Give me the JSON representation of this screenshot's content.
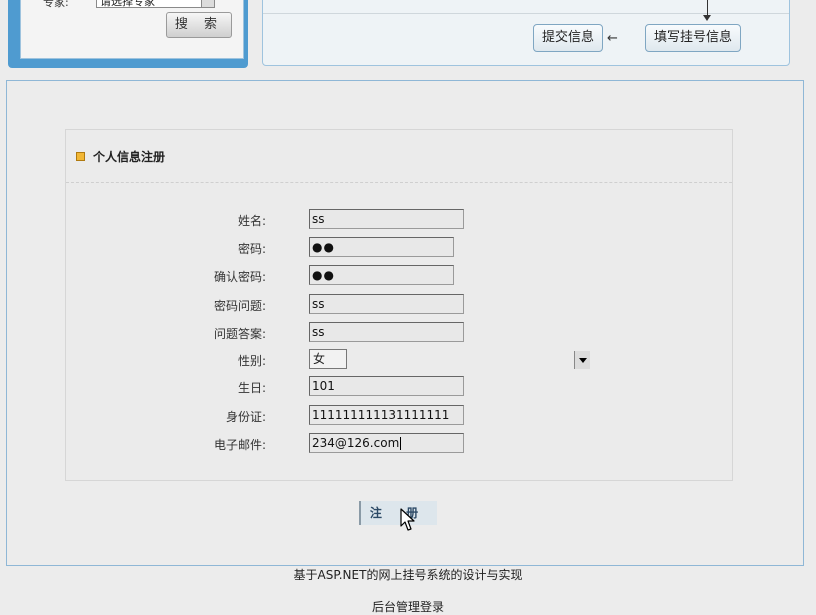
{
  "search": {
    "label": "专家:",
    "select_value": "请选择专家",
    "button_label": "搜 索"
  },
  "flow": {
    "step_submit": "提交信息",
    "step_fill": "填写挂号信息",
    "arrow_glyph": "←"
  },
  "form": {
    "title": "个人信息注册",
    "fields": {
      "name": {
        "label": "姓名:",
        "value": "ss"
      },
      "password": {
        "label": "密码:",
        "value": "●●"
      },
      "confirm_password": {
        "label": "确认密码:",
        "value": "●●"
      },
      "security_question": {
        "label": "密码问题:",
        "value": "ss"
      },
      "security_answer": {
        "label": "问题答案:",
        "value": "ss"
      },
      "gender": {
        "label": "性别:",
        "value": "女"
      },
      "birthday": {
        "label": "生日:",
        "value": "101"
      },
      "id_card": {
        "label": "身份证:",
        "value": "111111111131111111"
      },
      "email": {
        "label": "电子邮件:",
        "value": "234@126.com"
      }
    },
    "register_button": "注 册"
  },
  "footer": {
    "title": "基于ASP.NET的网上挂号系统的设计与实现",
    "admin_login": "后台管理登录"
  },
  "colors": {
    "accent_blue": "#4f9bd0",
    "panel_border": "#8fb7d6",
    "title_icon": "#f2b735",
    "page_background": "#ececec"
  }
}
